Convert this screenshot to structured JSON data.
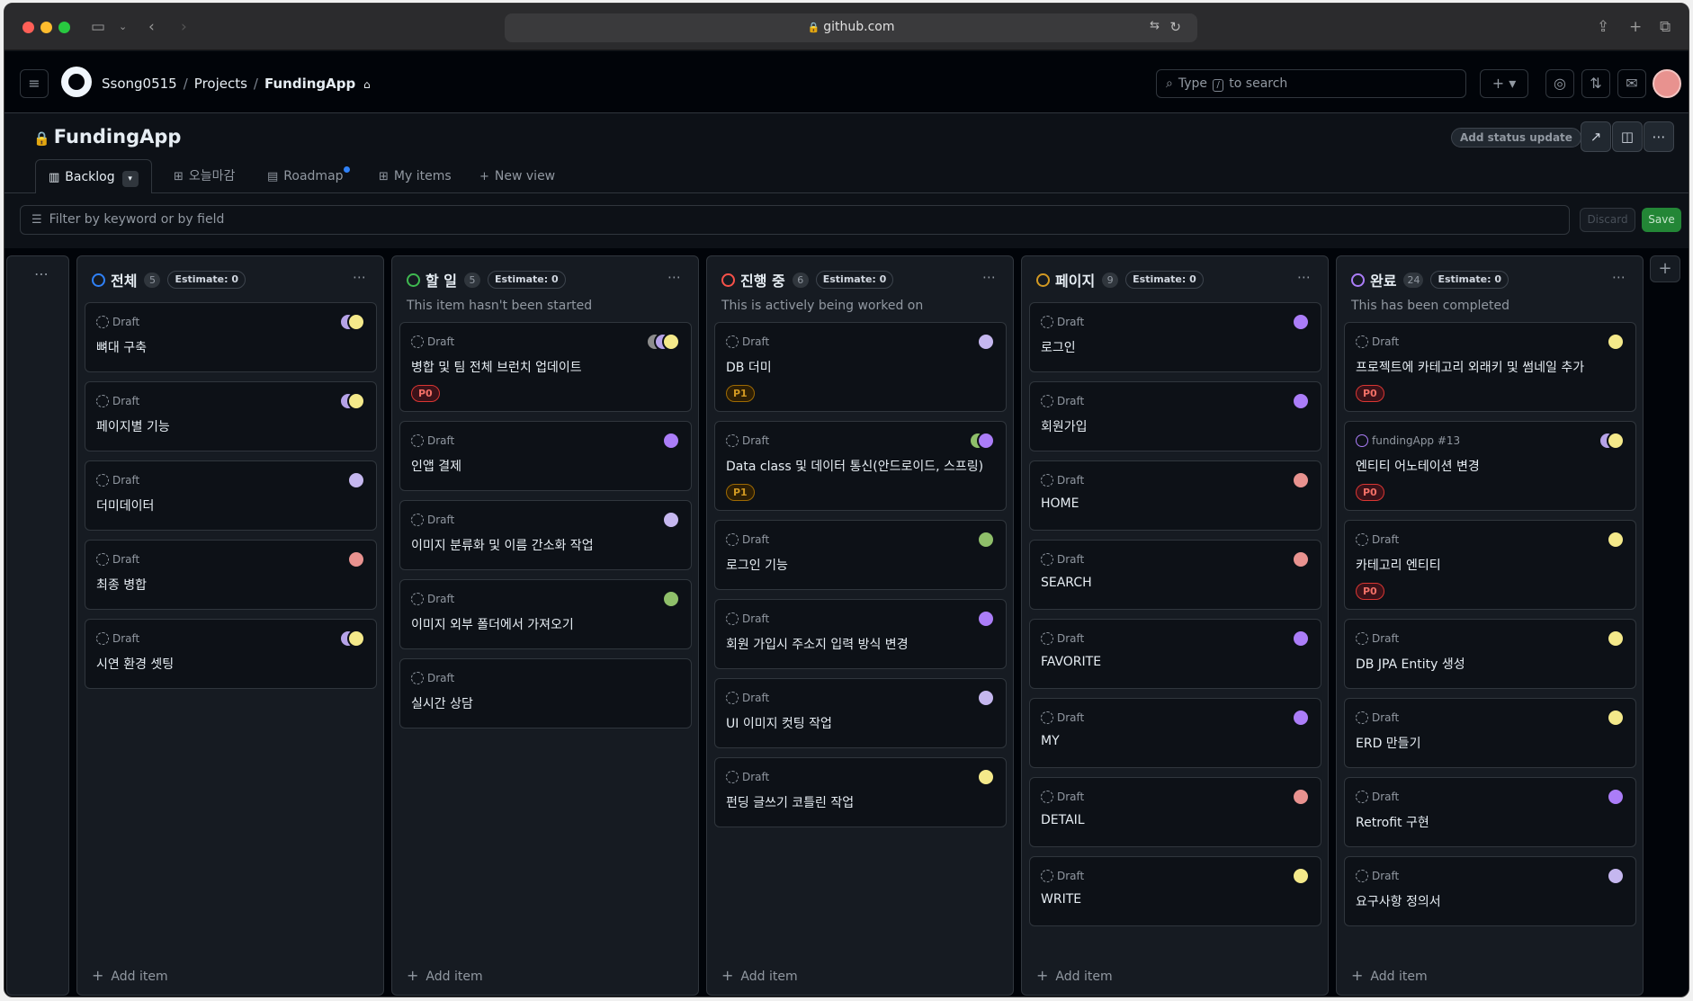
{
  "browser": {
    "url": "github.com"
  },
  "header": {
    "breadcrumb": [
      "Ssong0515",
      "Projects",
      "FundingApp"
    ],
    "search_pre": "Type",
    "search_key": "/",
    "search_post": "to search"
  },
  "project": {
    "title": "FundingApp",
    "status_update": "Add status update",
    "tabs": [
      "Backlog",
      "오늘마감",
      "Roadmap",
      "My items"
    ],
    "new_view": "New view",
    "filter_placeholder": "Filter by keyword or by field",
    "discard": "Discard",
    "save": "Save"
  },
  "colors": {
    "todo": "#3fb950",
    "inprogress": "#f85149",
    "page": "#d29922",
    "done": "#ab7df8",
    "all": "#2f81f7"
  },
  "columns": [
    {
      "name": "전체",
      "count": "5",
      "estimate": "Estimate: 0",
      "desc": "",
      "color": "#2f81f7",
      "cards": [
        {
          "meta": "Draft",
          "title": "뼈대 구축",
          "prio": "",
          "avatars": [
            "#b6a3e8",
            "#f4e98a"
          ]
        },
        {
          "meta": "Draft",
          "title": "페이지별 기능",
          "prio": "",
          "avatars": [
            "#b6a3e8",
            "#f4e98a"
          ]
        },
        {
          "meta": "Draft",
          "title": "더미데이터",
          "prio": "",
          "avatars": [
            "#c5b7ef"
          ]
        },
        {
          "meta": "Draft",
          "title": "최종 병합",
          "prio": "",
          "avatars": [
            "#e8928f"
          ]
        },
        {
          "meta": "Draft",
          "title": "시연 환경 셋팅",
          "prio": "",
          "avatars": [
            "#b6a3e8",
            "#f4e98a"
          ]
        }
      ],
      "add": "Add item"
    },
    {
      "name": "할 일",
      "count": "5",
      "estimate": "Estimate: 0",
      "desc": "This item hasn't been started",
      "color": "#3fb950",
      "cards": [
        {
          "meta": "Draft",
          "title": "병합 및 팀 전체 브런치 업데이트",
          "prio": "P0",
          "avatars": [
            "#8d8d8d",
            "#b6a3e8",
            "#f4e98a"
          ]
        },
        {
          "meta": "Draft",
          "title": "인앱 결제",
          "prio": "",
          "avatars": [
            "#ab7df8"
          ]
        },
        {
          "meta": "Draft",
          "title": "이미지 분류화 및 이름 간소화 작업",
          "prio": "",
          "avatars": [
            "#c5b7ef"
          ]
        },
        {
          "meta": "Draft",
          "title": "이미지 외부 폴더에서 가져오기",
          "prio": "",
          "avatars": [
            "#8fbf6a"
          ]
        },
        {
          "meta": "Draft",
          "title": "실시간 상담",
          "prio": "",
          "avatars": []
        }
      ],
      "add": "Add item"
    },
    {
      "name": "진행 중",
      "count": "6",
      "estimate": "Estimate: 0",
      "desc": "This is actively being worked on",
      "color": "#f85149",
      "cards": [
        {
          "meta": "Draft",
          "title": "DB 더미",
          "prio": "P1",
          "avatars": [
            "#c5b7ef"
          ]
        },
        {
          "meta": "Draft",
          "title": "Data class 및 데이터 통신(안드로이드, 스프링)",
          "prio": "P1",
          "avatars": [
            "#8fbf6a",
            "#ab7df8"
          ]
        },
        {
          "meta": "Draft",
          "title": "로그인 기능",
          "prio": "",
          "avatars": [
            "#8fbf6a"
          ]
        },
        {
          "meta": "Draft",
          "title": "회원 가입시 주소지 입력 방식 변경",
          "prio": "",
          "avatars": [
            "#ab7df8"
          ]
        },
        {
          "meta": "Draft",
          "title": "UI 이미지 컷팅 작업",
          "prio": "",
          "avatars": [
            "#c5b7ef"
          ]
        },
        {
          "meta": "Draft",
          "title": "펀딩 글쓰기 코틀린 작업",
          "prio": "",
          "avatars": [
            "#f4e98a"
          ]
        }
      ],
      "add": "Add item"
    },
    {
      "name": "페이지",
      "count": "9",
      "estimate": "Estimate: 0",
      "desc": "",
      "color": "#d29922",
      "cards": [
        {
          "meta": "Draft",
          "title": "로그인",
          "prio": "",
          "avatars": [
            "#ab7df8"
          ]
        },
        {
          "meta": "Draft",
          "title": "회원가입",
          "prio": "",
          "avatars": [
            "#ab7df8"
          ]
        },
        {
          "meta": "Draft",
          "title": "HOME",
          "prio": "",
          "avatars": [
            "#e8928f"
          ]
        },
        {
          "meta": "Draft",
          "title": "SEARCH",
          "prio": "",
          "avatars": [
            "#e8928f"
          ]
        },
        {
          "meta": "Draft",
          "title": "FAVORITE",
          "prio": "",
          "avatars": [
            "#ab7df8"
          ]
        },
        {
          "meta": "Draft",
          "title": "MY",
          "prio": "",
          "avatars": [
            "#ab7df8"
          ]
        },
        {
          "meta": "Draft",
          "title": "DETAIL",
          "prio": "",
          "avatars": [
            "#e8928f"
          ]
        },
        {
          "meta": "Draft",
          "title": "WRITE",
          "prio": "",
          "avatars": [
            "#f4e98a"
          ]
        }
      ],
      "add": "Add item"
    },
    {
      "name": "완료",
      "count": "24",
      "estimate": "Estimate: 0",
      "desc": "This has been completed",
      "color": "#ab7df8",
      "cards": [
        {
          "meta": "Draft",
          "title": "프로젝트에 카테고리 외래키 및 썸네일 추가",
          "prio": "P0",
          "avatars": [
            "#f4e98a"
          ]
        },
        {
          "meta": "fundingApp #13",
          "title": "엔티티 어노테이션 변경",
          "prio": "P0",
          "avatars": [
            "#b6a3e8",
            "#f4e98a"
          ],
          "done": true
        },
        {
          "meta": "Draft",
          "title": "카테고리 엔티티",
          "prio": "P0",
          "avatars": [
            "#f4e98a"
          ]
        },
        {
          "meta": "Draft",
          "title": "DB JPA Entity 생성",
          "prio": "",
          "avatars": [
            "#f4e98a"
          ]
        },
        {
          "meta": "Draft",
          "title": "ERD 만들기",
          "prio": "",
          "avatars": [
            "#f4e98a"
          ]
        },
        {
          "meta": "Draft",
          "title": "Retrofit 구현",
          "prio": "",
          "avatars": [
            "#ab7df8"
          ]
        },
        {
          "meta": "Draft",
          "title": "요구사항 정의서",
          "prio": "",
          "avatars": [
            "#c5b7ef"
          ]
        }
      ],
      "add": "Add item"
    }
  ]
}
